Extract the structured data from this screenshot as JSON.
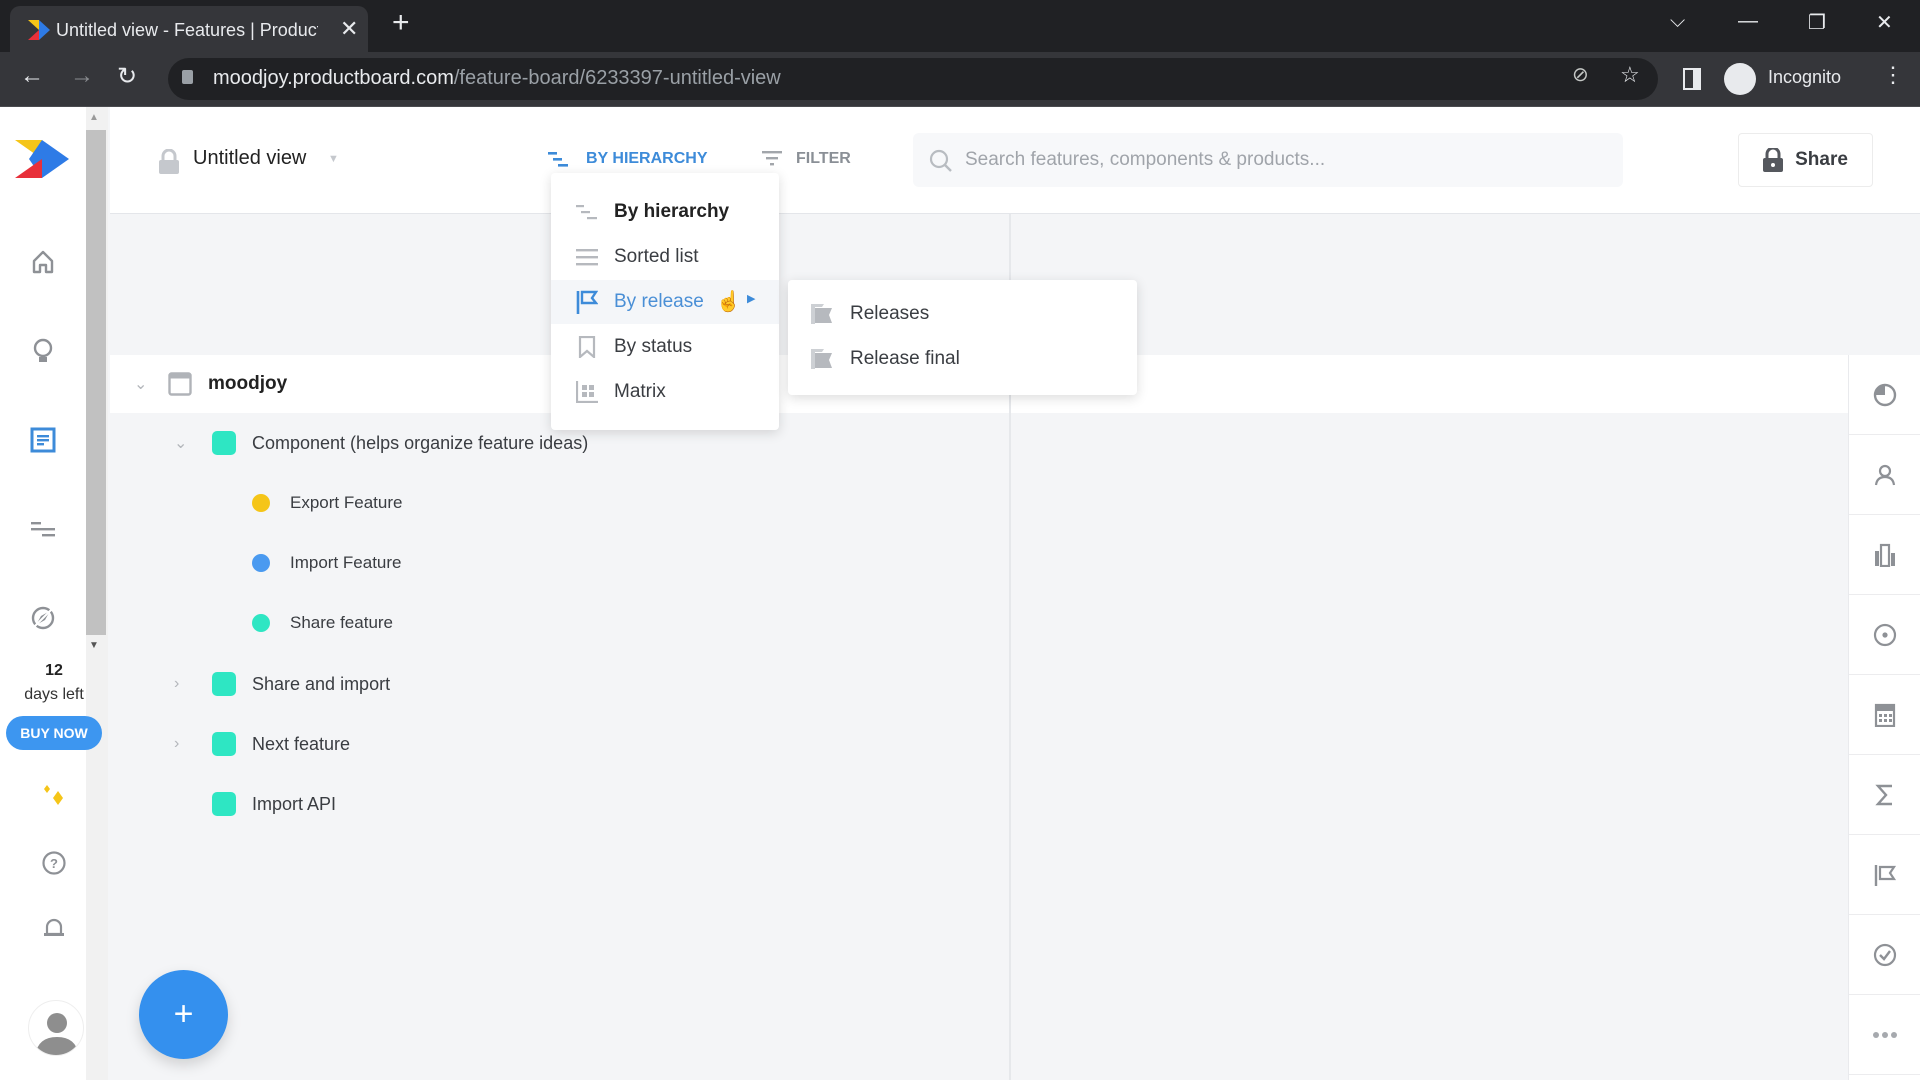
{
  "browser": {
    "tab_title": "Untitled view - Features | Productboard",
    "new_tab_icon": "plus-icon",
    "url_host": "moodjoy.productboard.com",
    "url_path": "/feature-board/6233397-untitled-view",
    "profile_label": "Incognito"
  },
  "sidebar": {
    "items": [
      {
        "name": "home",
        "icon": "home-icon"
      },
      {
        "name": "insights",
        "icon": "lightbulb-icon"
      },
      {
        "name": "features",
        "icon": "features-board-icon",
        "active": true
      },
      {
        "name": "roadmaps",
        "icon": "roadmap-icon"
      },
      {
        "name": "strategy",
        "icon": "compass-icon"
      }
    ],
    "trial_days": "12",
    "trial_label": "days left",
    "buy_now_label": "BUY NOW",
    "bottom": [
      "sparkle-icon",
      "help-icon",
      "bell-icon",
      "avatar"
    ]
  },
  "header": {
    "view_title": "Untitled view",
    "grouping_label": "BY HIERARCHY",
    "filter_label": "FILTER",
    "search_placeholder": "Search features, components & products...",
    "share_label": "Share"
  },
  "grouping_menu": {
    "items": [
      {
        "label": "By hierarchy",
        "icon": "hierarchy-icon",
        "selected": true
      },
      {
        "label": "Sorted list",
        "icon": "list-icon"
      },
      {
        "label": "By release",
        "icon": "release-flag-icon",
        "hovered": true,
        "has_submenu": true
      },
      {
        "label": "By status",
        "icon": "bookmark-icon"
      },
      {
        "label": "Matrix",
        "icon": "matrix-icon"
      }
    ],
    "submenu": [
      {
        "label": "Releases",
        "icon": "release-group-icon"
      },
      {
        "label": "Release final",
        "icon": "release-group-icon"
      }
    ]
  },
  "tree": {
    "root": {
      "label": "moodjoy",
      "expanded": true
    },
    "rows": [
      {
        "label": "Component (helps organize feature ideas)",
        "type": "component",
        "level": 1,
        "expanded": true,
        "color": "#2ee6c3"
      },
      {
        "label": "Export Feature",
        "type": "feature",
        "level": 2,
        "color": "#f5c518"
      },
      {
        "label": "Import Feature",
        "type": "feature",
        "level": 2,
        "color": "#4a9af0"
      },
      {
        "label": "Share feature",
        "type": "feature",
        "level": 2,
        "color": "#2ee6c3"
      },
      {
        "label": "Share and import",
        "type": "component",
        "level": 1,
        "expanded": false,
        "color": "#2ee6c3"
      },
      {
        "label": "Next feature",
        "type": "component",
        "level": 1,
        "expanded": false,
        "color": "#2ee6c3"
      },
      {
        "label": "Import API",
        "type": "component",
        "level": 1,
        "color": "#2ee6c3"
      }
    ]
  },
  "right_rail": [
    "progress-pie-icon",
    "user-icon",
    "company-icon",
    "target-icon",
    "calculator-icon",
    "sigma-icon",
    "release-flag-icon",
    "check-circle-icon",
    "more-icon"
  ],
  "colors": {
    "accent": "#3d8bd9",
    "fab": "#3490ee",
    "buy_now": "#3d96f0"
  }
}
